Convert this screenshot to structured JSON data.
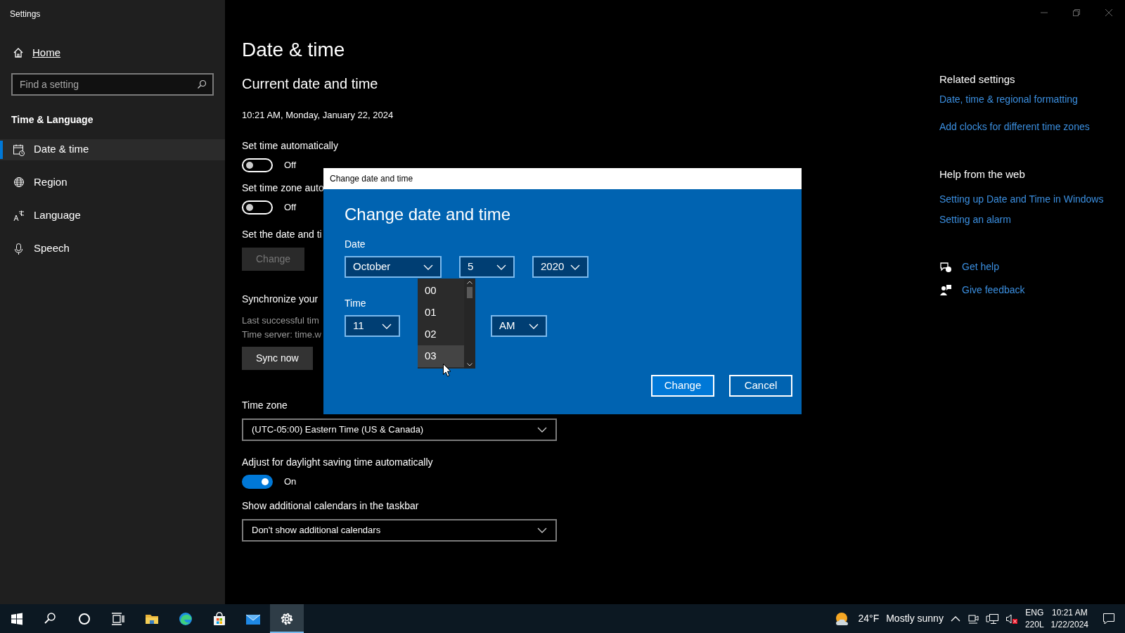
{
  "window": {
    "title": "Settings"
  },
  "sidebar": {
    "home": "Home",
    "search": {
      "placeholder": "Find a setting"
    },
    "section": "Time & Language",
    "items": [
      {
        "label": "Date & time",
        "selected": true
      },
      {
        "label": "Region",
        "selected": false
      },
      {
        "label": "Language",
        "selected": false
      },
      {
        "label": "Speech",
        "selected": false
      }
    ]
  },
  "main": {
    "title": "Date & time",
    "subtitle": "Current date and time",
    "current": "10:21 AM, Monday, January 22, 2024",
    "settings": [
      {
        "kind": "toggle",
        "label": "Set time automatically",
        "on": false,
        "state_text": "Off"
      },
      {
        "kind": "toggle",
        "label": "Set time zone auto",
        "on": false,
        "state_text": "Off"
      },
      {
        "kind": "button",
        "label": "Set the date and ti",
        "button": "Change",
        "disabled": true
      },
      {
        "kind": "sync",
        "label": "Synchronize your",
        "lines": [
          "Last successful tim",
          "Time server: time.w"
        ],
        "button": "Sync now"
      },
      {
        "kind": "select",
        "label": "Time zone",
        "value": "(UTC-05:00) Eastern Time (US & Canada)"
      },
      {
        "kind": "toggle",
        "label": "Adjust for daylight saving time automatically",
        "on": true,
        "state_text": "On"
      },
      {
        "kind": "select",
        "label": "Show additional calendars in the taskbar",
        "value": "Don't show additional calendars"
      }
    ]
  },
  "related": {
    "title": "Related settings",
    "links": [
      "Date, time & regional formatting",
      "Add clocks for different time zones"
    ]
  },
  "help": {
    "title": "Help from the web",
    "links": [
      "Setting up Date and Time in Windows",
      "Setting an alarm"
    ]
  },
  "support": [
    "Get help",
    "Give feedback"
  ],
  "dialog": {
    "title": "Change date and time",
    "heading": "Change date and time",
    "date_label": "Date",
    "date": [
      "October",
      "5",
      "2020"
    ],
    "time_label": "Time",
    "time": [
      "11",
      "AM"
    ],
    "hour_list": [
      {
        "label": "00",
        "highlighted": false
      },
      {
        "label": "01",
        "highlighted": false
      },
      {
        "label": "02",
        "highlighted": false
      },
      {
        "label": "03",
        "highlighted": true
      }
    ],
    "buttons": [
      {
        "label": "Change",
        "primary": true
      },
      {
        "label": "Cancel",
        "primary": false
      }
    ]
  },
  "taskbar": {
    "apps": [
      {
        "selected": false
      },
      {
        "selected": false
      },
      {
        "selected": false
      },
      {
        "selected": false
      },
      {
        "selected": false
      },
      {
        "selected": false
      },
      {
        "selected": false
      },
      {
        "selected": false
      },
      {
        "selected": true
      }
    ],
    "temperature": "24°F",
    "weather": "Mostly sunny",
    "language": "ENG",
    "layout": "220L",
    "time": "10:21 AM",
    "date": "1/22/2024"
  }
}
